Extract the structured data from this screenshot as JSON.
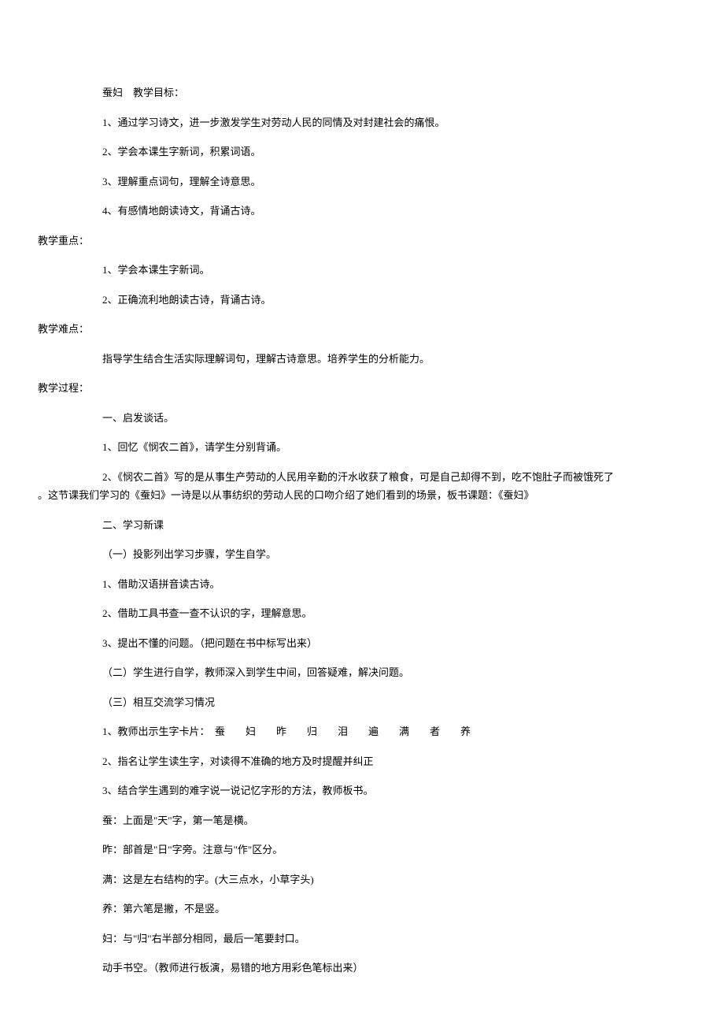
{
  "lines": {
    "l01": "蚕妇　教学目标：",
    "l02": "1、通过学习诗文，进一步激发学生对劳动人民的同情及对封建社会的痛恨。",
    "l03": "2、学会本课生字新词，积累词语。",
    "l04": "3、理解重点词句，理解全诗意思。",
    "l05": "4、有感情地朗读诗文，背诵古诗。",
    "l06": "教学重点：",
    "l07": "1、学会本课生字新词。",
    "l08": "2、正确流利地朗读古诗，背诵古诗。",
    "l09": "教学难点：",
    "l10": "指导学生结合生活实际理解词句，理解古诗意思。培养学生的分析能力。",
    "l11": "教学过程：",
    "l12": "一、启发谈话。",
    "l13": "1、回忆《悯农二首》，请学生分别背诵。",
    "l14a": "2、《悯农二首》写的是从事生产劳动的人民用辛勤的汗水收获了粮食，可是自己却得不到，吃不饱肚子而被饿死了",
    "l14b": "。这节课我们学习的《蚕妇》一诗是以从事纺织的劳动人民的口吻介绍了她们看到的场景，板书课题：《蚕妇》",
    "l15": "二、学习新课",
    "l16": "（一）投影列出学习步骤，学生自学。",
    "l17": "1、借助汉语拼音读古诗。",
    "l18": "2、借助工具书查一查不认识的字，理解意思。",
    "l19": "3、提出不懂的问题。（把问题在书中标写出来）",
    "l20": "（二）学生进行自学，教师深入到学生中间，回答疑难，解决问题。",
    "l21": "（三）相互交流学习情况",
    "l22": "1、教师出示生字卡片：　蚕　　妇　　昨　　归　　泪　　遍　　满　　者　　养",
    "l23": "2、指名让学生读生字，对读得不准确的地方及时提醒并纠正",
    "l24": "3、结合学生遇到的难字说一说记忆字形的方法，教师板书。",
    "l25": "蚕：上面是\"天\"字，第一笔是横。",
    "l26": "昨：部首是\"日\"字旁。注意与\"作\"区分。",
    "l27": "满：这是左右结构的字。(大三点水，小草字头)",
    "l28": "养：第六笔是撇，不是竖。",
    "l29": "妇：与\"归\"右半部分相同，最后一笔要封口。",
    "l30": "动手书空。（教师进行板演，易错的地方用彩色笔标出来）"
  }
}
